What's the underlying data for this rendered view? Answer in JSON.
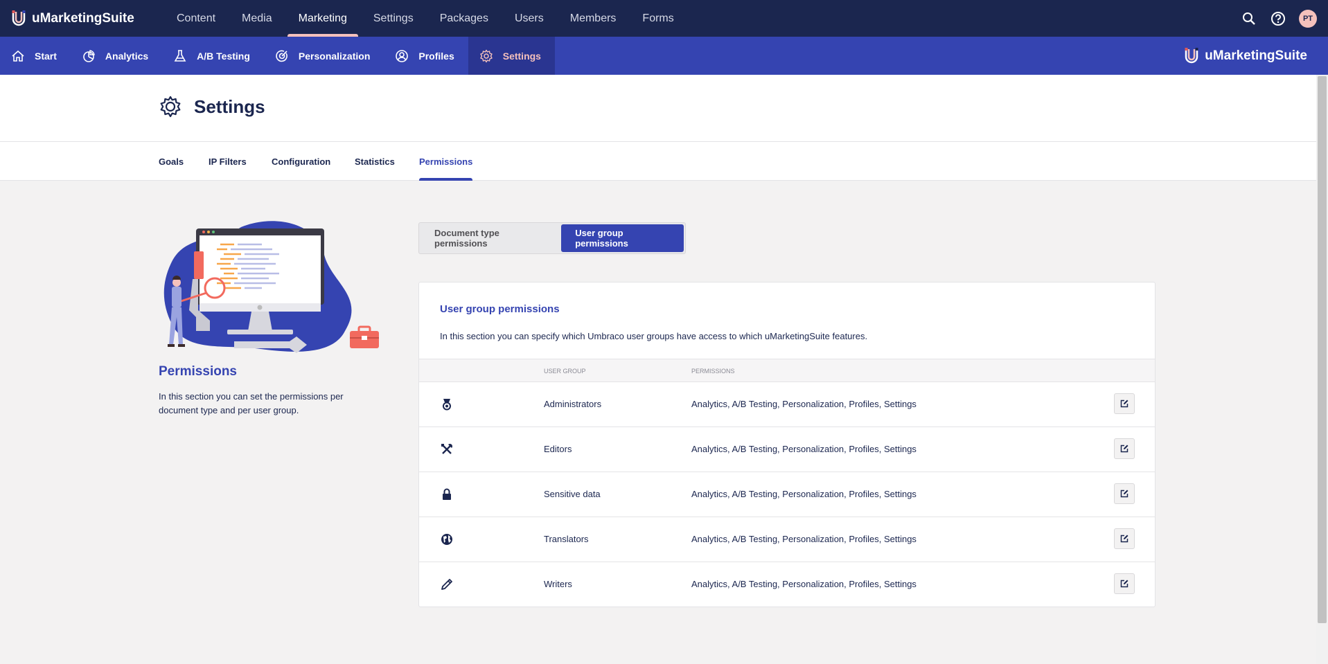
{
  "topbar": {
    "brand": "uMarketingSuite",
    "nav": [
      "Content",
      "Media",
      "Marketing",
      "Settings",
      "Packages",
      "Users",
      "Members",
      "Forms"
    ],
    "active_index": 2,
    "avatar": "PT"
  },
  "subbar": {
    "items": [
      {
        "label": "Start",
        "icon": "home-icon"
      },
      {
        "label": "Analytics",
        "icon": "pie-chart-icon"
      },
      {
        "label": "A/B Testing",
        "icon": "flask-icon"
      },
      {
        "label": "Personalization",
        "icon": "target-icon"
      },
      {
        "label": "Profiles",
        "icon": "user-circle-icon"
      },
      {
        "label": "Settings",
        "icon": "gear-icon"
      }
    ],
    "brand": "uMarketingSuite"
  },
  "header": {
    "title": "Settings"
  },
  "tabs": [
    "Goals",
    "IP Filters",
    "Configuration",
    "Statistics",
    "Permissions"
  ],
  "left": {
    "title": "Permissions",
    "description": "In this section you can set the permissions per document type and per user group."
  },
  "toggle": {
    "document_type": "Document type permissions",
    "user_group": "User group permissions"
  },
  "card": {
    "title": "User group permissions",
    "description": "In this section you can specify which Umbraco user groups have access to which uMarketingSuite features.",
    "col_user_group": "USER GROUP",
    "col_permissions": "PERMISSIONS",
    "rows": [
      {
        "icon": "medal-icon",
        "name": "Administrators",
        "permissions": "Analytics, A/B Testing, Personalization, Profiles, Settings"
      },
      {
        "icon": "tools-icon",
        "name": "Editors",
        "permissions": "Analytics, A/B Testing, Personalization, Profiles, Settings"
      },
      {
        "icon": "lock-icon",
        "name": "Sensitive data",
        "permissions": "Analytics, A/B Testing, Personalization, Profiles, Settings"
      },
      {
        "icon": "globe-icon",
        "name": "Translators",
        "permissions": "Analytics, A/B Testing, Personalization, Profiles, Settings"
      },
      {
        "icon": "pencil-icon",
        "name": "Writers",
        "permissions": "Analytics, A/B Testing, Personalization, Profiles, Settings"
      }
    ]
  },
  "colors": {
    "navy": "#1b264f",
    "blue": "#3544b1",
    "pink": "#f5c1bc"
  }
}
